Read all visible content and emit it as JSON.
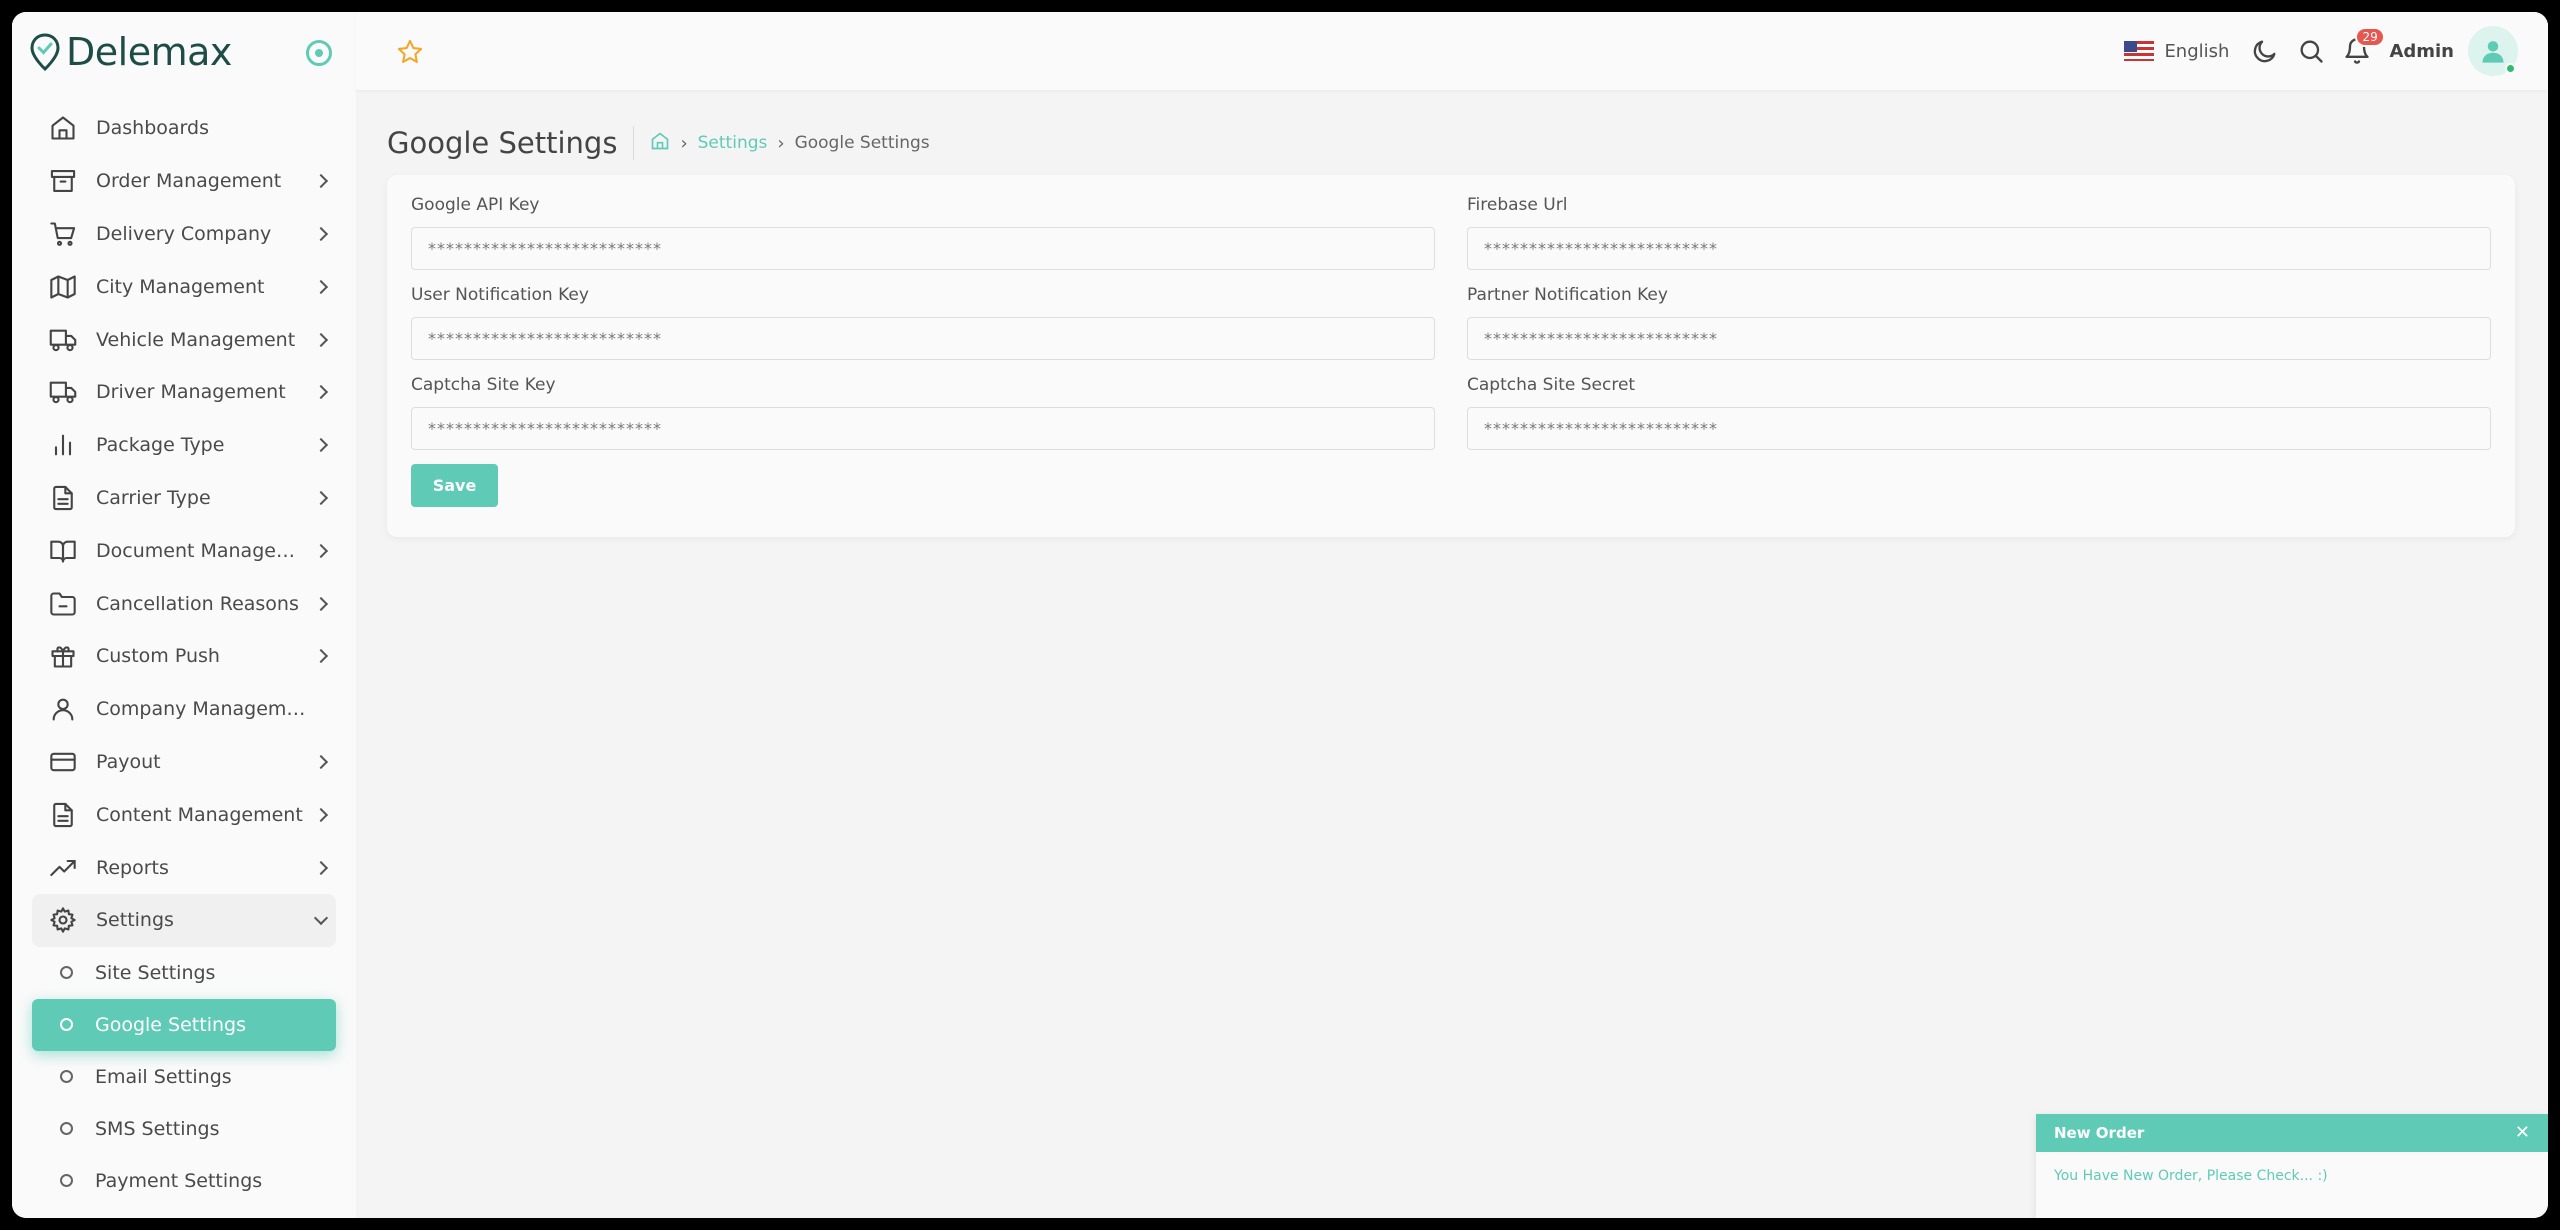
{
  "brand": {
    "name": "Delemax",
    "accent": "#5fcbb7"
  },
  "topbar": {
    "language": "English",
    "notification_count": "29",
    "user_name": "Admin"
  },
  "sidebar": {
    "items": [
      {
        "label": "Dashboards",
        "icon": "home-icon",
        "has_children": false
      },
      {
        "label": "Order Management",
        "icon": "archive-icon",
        "has_children": true
      },
      {
        "label": "Delivery Company",
        "icon": "cart-icon",
        "has_children": true
      },
      {
        "label": "City Management",
        "icon": "map-icon",
        "has_children": true
      },
      {
        "label": "Vehicle Management",
        "icon": "truck-icon",
        "has_children": true
      },
      {
        "label": "Driver Management",
        "icon": "truck-icon",
        "has_children": true
      },
      {
        "label": "Package Type",
        "icon": "bar-chart-icon",
        "has_children": true
      },
      {
        "label": "Carrier Type",
        "icon": "file-text-icon",
        "has_children": true
      },
      {
        "label": "Document Management",
        "icon": "book-icon",
        "has_children": true
      },
      {
        "label": "Cancellation Reasons",
        "icon": "folder-minus-icon",
        "has_children": true
      },
      {
        "label": "Custom Push",
        "icon": "gift-icon",
        "has_children": true
      },
      {
        "label": "Company Management",
        "icon": "user-icon",
        "has_children": false
      },
      {
        "label": "Payout",
        "icon": "credit-card-icon",
        "has_children": true
      },
      {
        "label": "Content Management",
        "icon": "file-text-icon",
        "has_children": true
      },
      {
        "label": "Reports",
        "icon": "trending-up-icon",
        "has_children": true
      },
      {
        "label": "Settings",
        "icon": "gear-icon",
        "has_children": true
      }
    ],
    "settings_sub": [
      {
        "label": "Site Settings",
        "active": false
      },
      {
        "label": "Google Settings",
        "active": true
      },
      {
        "label": "Email Settings",
        "active": false
      },
      {
        "label": "SMS Settings",
        "active": false
      },
      {
        "label": "Payment Settings",
        "active": false
      }
    ]
  },
  "page": {
    "title": "Google Settings",
    "breadcrumb": {
      "parent": "Settings",
      "current": "Google Settings"
    }
  },
  "form": {
    "fields": [
      {
        "label": "Google API Key",
        "value": "**************************"
      },
      {
        "label": "Firebase Url",
        "value": "**************************"
      },
      {
        "label": "User Notification Key",
        "value": "**************************"
      },
      {
        "label": "Partner Notification Key",
        "value": "**************************"
      },
      {
        "label": "Captcha Site Key",
        "value": "**************************"
      },
      {
        "label": "Captcha Site Secret",
        "value": "**************************"
      }
    ],
    "save_label": "Save"
  },
  "toast": {
    "title": "New Order",
    "message": "You Have New Order, Please Check... :)"
  }
}
